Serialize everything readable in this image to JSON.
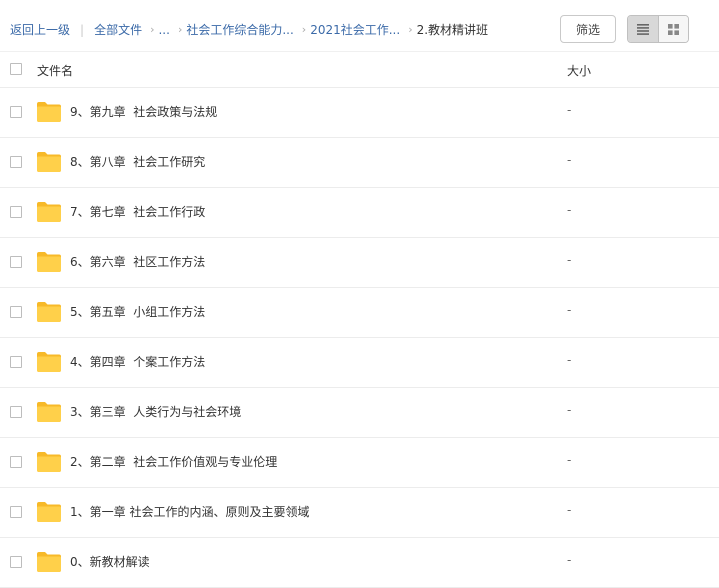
{
  "breadcrumb": {
    "back": "返回上一级",
    "all_files": "全部文件",
    "ellipsis": "...",
    "level1": "社会工作综合能力...",
    "level2": "2021社会工作...",
    "current": "2.教材精讲班"
  },
  "toolbar": {
    "filter_label": "筛选",
    "view_list_icon": "list-view-icon",
    "view_grid_icon": "grid-view-icon"
  },
  "columns": {
    "name": "文件名",
    "size": "大小"
  },
  "colors": {
    "link": "#3b6aa8",
    "folder": "#ffd04a",
    "folder_tab": "#f7b928"
  },
  "files": [
    {
      "name": "9、第九章  社会政策与法规",
      "size": "-"
    },
    {
      "name": "8、第八章  社会工作研究",
      "size": "-"
    },
    {
      "name": "7、第七章  社会工作行政",
      "size": "-"
    },
    {
      "name": "6、第六章  社区工作方法",
      "size": "-"
    },
    {
      "name": "5、第五章  小组工作方法",
      "size": "-"
    },
    {
      "name": "4、第四章  个案工作方法",
      "size": "-"
    },
    {
      "name": "3、第三章  人类行为与社会环境",
      "size": "-"
    },
    {
      "name": "2、第二章  社会工作价值观与专业伦理",
      "size": "-"
    },
    {
      "name": "1、第一章 社会工作的内涵、原则及主要领域",
      "size": "-"
    },
    {
      "name": "0、新教材解读",
      "size": "-"
    }
  ]
}
